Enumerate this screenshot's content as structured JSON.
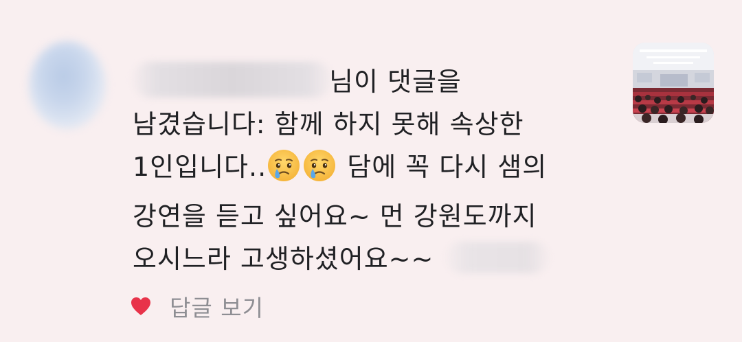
{
  "comment": {
    "line1_suffix": "님이 댓글을",
    "line2": "남겼습니다: 함께 하지 못해 속상한",
    "line3_before": "1인입니다..",
    "line3_after": " 담에 꼭 다시 샘의",
    "line4": "강연을 듣고 싶어요~  먼 강원도까지",
    "line5": "오시느라 고생하셨어요~~",
    "emoji_name": "crying-face-icon"
  },
  "footer": {
    "reply_label": "답글 보기",
    "heart_color": "#e8334a"
  },
  "colors": {
    "background": "#f9eff0",
    "text": "#202124",
    "secondary_text": "#8e8e93"
  }
}
